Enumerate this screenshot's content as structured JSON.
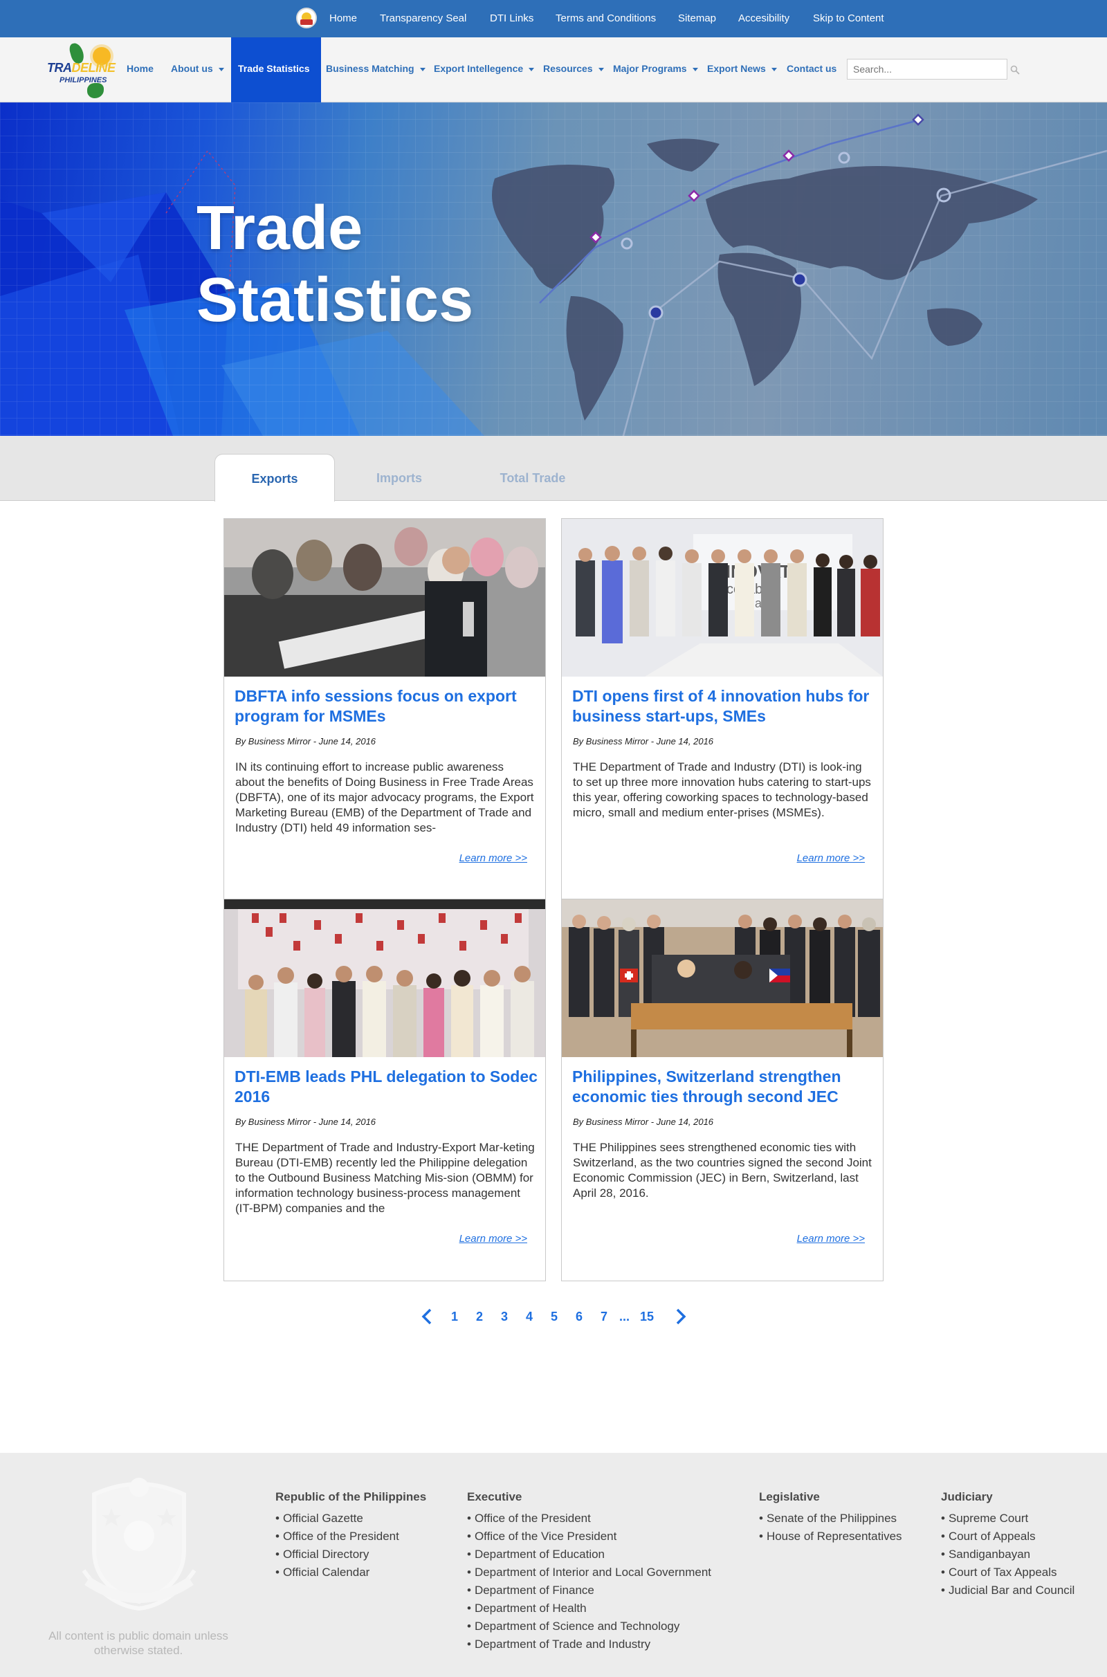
{
  "topbar": {
    "links": [
      "Home",
      "Transparency Seal",
      "DTI Links",
      "Terms and Conditions",
      "Sitemap",
      "Accesibility",
      "Skip to Content"
    ]
  },
  "logo": {
    "part1": "TRA",
    "part2": "DELINE",
    "sub": "PHILIPPINES"
  },
  "nav": {
    "items": [
      {
        "label": "Home",
        "dropdown": false
      },
      {
        "label": "About us",
        "dropdown": true
      },
      {
        "label": "Trade Statistics",
        "dropdown": false,
        "active": true
      },
      {
        "label": "Business Matching",
        "dropdown": true
      },
      {
        "label": "Export Intellegence",
        "dropdown": true
      },
      {
        "label": "Resources",
        "dropdown": true
      },
      {
        "label": "Major Programs",
        "dropdown": true
      },
      {
        "label": "Export News",
        "dropdown": true
      },
      {
        "label": "Contact us",
        "dropdown": false
      }
    ],
    "search_placeholder": "Search..."
  },
  "hero": {
    "title_line1": "Trade",
    "title_line2": "Statistics"
  },
  "tabs": [
    {
      "label": "Exports",
      "active": true
    },
    {
      "label": "Imports",
      "active": false
    },
    {
      "label": "Total Trade",
      "active": false
    }
  ],
  "cards": [
    {
      "title": "DBFTA info sessions focus on export program for MSMEs",
      "byline": "By Business Mirror - June 14, 2016",
      "excerpt": "IN its continuing effort to increase public awareness about the benefits of Doing Business in Free Trade Areas (DBFTA), one of its major advocacy programs, the Export Marketing Bureau (EMB) of the Department of Trade and Industry (DTI) held 49 information ses-",
      "more": "Learn more >>"
    },
    {
      "title": "DTI opens first of 4 innovation hubs for business start-ups, SMEs",
      "byline": "By Business Mirror - June 14, 2016",
      "excerpt": "THE Department of Trade and Industry (DTI) is look-ing to set up three more innovation hubs catering to start-ups this year, offering coworking spaces to technology-based micro, small and medium enter-prises (MSMEs).",
      "more": "Learn more >>",
      "photo_text": [
        "INNOVATE",
        "collabor",
        "shar"
      ]
    },
    {
      "title": "DTI-EMB leads PHL delegation to Sodec 2016",
      "byline": "By Business Mirror - June 14, 2016",
      "excerpt": "THE Department of Trade and Industry-Export Mar-keting Bureau (DTI-EMB) recently led the Philippine delegation to the Outbound Business Matching Mis-sion (OBMM) for information technology business-process management (IT-BPM) companies and the",
      "more": "Learn more >>"
    },
    {
      "title": "Philippines, Switzerland strengthen economic ties through second JEC",
      "byline": "By Business Mirror - June 14, 2016",
      "excerpt": "THE Philippines sees strengthened economic ties with Switzerland, as the two countries signed the second Joint Economic Commission (JEC) in Bern, Switzerland, last April 28, 2016.",
      "more": "Learn more >>"
    }
  ],
  "pagination": {
    "pages": [
      "1",
      "2",
      "3",
      "4",
      "5",
      "6",
      "7"
    ],
    "ellipsis": "...",
    "last": "15"
  },
  "footer": {
    "note": "All content is public domain unless otherwise stated.",
    "columns": [
      {
        "heading": "Republic of the Philippines",
        "items": [
          "Official Gazette",
          "Office of the President",
          "Official Directory",
          "Official Calendar"
        ]
      },
      {
        "heading": "Executive",
        "items": [
          "Office of the President",
          "Office of the Vice President",
          "Department of Education",
          "Department of Interior and Local Government",
          "Department of Finance",
          "Department of Health",
          "Department of Science and Technology",
          "Department of Trade and Industry"
        ]
      },
      {
        "heading": "Legislative",
        "items": [
          "Senate of the Philippines",
          "House of Representatives"
        ]
      },
      {
        "heading": "Judiciary",
        "items": [
          "Supreme Court",
          "Court of Appeals",
          "Sandiganbayan",
          "Court of Tax Appeals",
          "Judicial Bar and Council"
        ]
      }
    ]
  },
  "colors": {
    "topbar": "#2e6fb8",
    "accent": "#1e6fe0",
    "nav_active": "#0d4fd1",
    "footer_bg": "#ececec"
  }
}
